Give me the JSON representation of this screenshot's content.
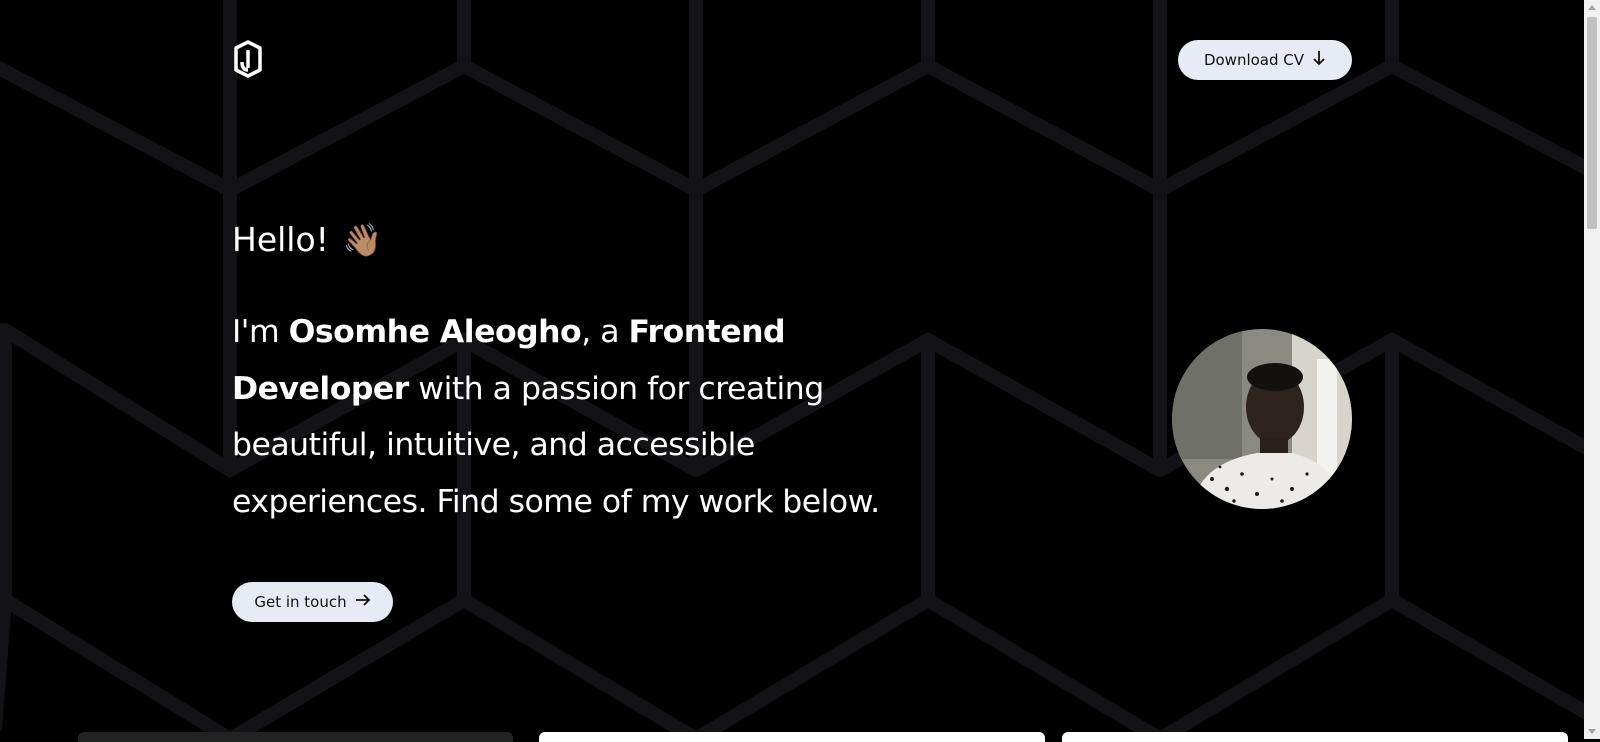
{
  "header": {
    "logo_icon": "jr-monogram-logo-icon",
    "download_cv_label": "Download CV",
    "download_icon": "arrow-down-icon"
  },
  "hero": {
    "greeting": "Hello!",
    "wave_emoji": "👋🏽",
    "intro_prefix": "I'm ",
    "name": "Osomhe Aleogho",
    "intro_mid": ", a ",
    "role": "Frontend Developer",
    "intro_suffix": " with a passion for creating beautiful, intuitive, and accessible experiences. Find some of my work below.",
    "cta_label": "Get in touch",
    "cta_icon": "arrow-right-icon",
    "avatar_icon": "profile-photo"
  },
  "colors": {
    "background": "#000000",
    "button_bg": "#e6ebf5",
    "hex_stroke": "#121217"
  }
}
